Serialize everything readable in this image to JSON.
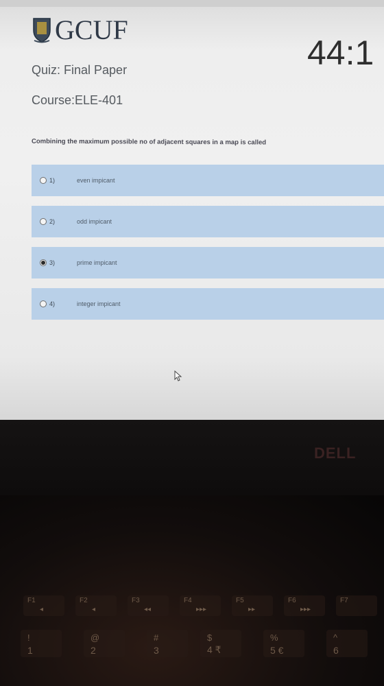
{
  "header": {
    "logo_text": "GCUF",
    "timer": "44:1",
    "quiz_label": "Quiz: Final Paper",
    "course_label": "Course:ELE-401"
  },
  "question": {
    "text": "Combining the maximum possible no of adjacent squares in a map is called",
    "selected_index": 2,
    "options": [
      {
        "num": "1)",
        "label": "even impicant",
        "selected": false
      },
      {
        "num": "2)",
        "label": "odd impicant",
        "selected": false
      },
      {
        "num": "3)",
        "label": "prime impicant",
        "selected": true
      },
      {
        "num": "4)",
        "label": "integer impicant",
        "selected": false
      }
    ]
  },
  "laptop": {
    "brand": "DELL",
    "function_keys": [
      {
        "top": "F1",
        "bot": "◂"
      },
      {
        "top": "F2",
        "bot": "◂"
      },
      {
        "top": "F3",
        "bot": "◂◂"
      },
      {
        "top": "F4",
        "bot": "▸▸▸"
      },
      {
        "top": "F5",
        "bot": "▸▸"
      },
      {
        "top": "F6",
        "bot": "▸▸▸"
      },
      {
        "top": "F7",
        "bot": ""
      }
    ],
    "number_keys": [
      {
        "top": "!",
        "bot": "1"
      },
      {
        "top": "@",
        "bot": "2"
      },
      {
        "top": "#",
        "bot": "3"
      },
      {
        "top": "$",
        "bot": "4 ₹"
      },
      {
        "top": "%",
        "bot": "5 €"
      },
      {
        "top": "^",
        "bot": "6"
      }
    ]
  },
  "colors": {
    "option_bg": "#b9d0e8",
    "screen_bg": "#f0f0f0",
    "timer_text": "#2e2e2e"
  }
}
